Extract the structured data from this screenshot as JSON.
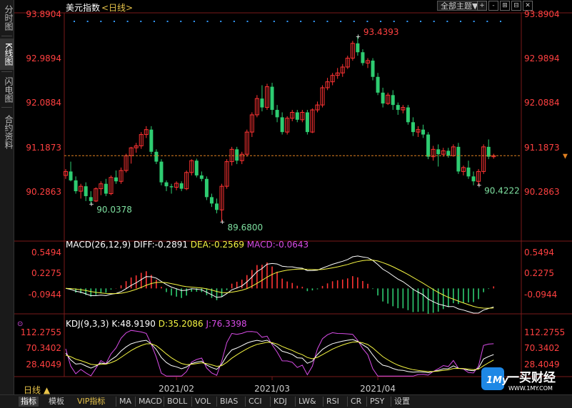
{
  "sidebar": {
    "tabs": [
      {
        "label": "分时图",
        "active": false
      },
      {
        "label": "K线图",
        "active": true
      },
      {
        "label": "闪电图",
        "active": false
      },
      {
        "label": "合约资料",
        "active": false
      }
    ]
  },
  "header": {
    "title": "美元指数",
    "period": "<日线>",
    "theme_select": "全部主题▼",
    "buttons": [
      "+",
      "-",
      "⊞",
      "⊟",
      "✕"
    ]
  },
  "period_selector": "日线 ▲",
  "bottom_tabs": [
    "指标",
    "模板",
    "VIP指标",
    "MA",
    "MACD",
    "BOLL",
    "VOL",
    "BIAS",
    "CCI",
    "KDJ",
    "LW&",
    "RSI",
    "CR",
    "PSY",
    "设置"
  ],
  "watermark": {
    "brand": "一买财经",
    "url": "WWW.1MY.COM"
  },
  "colors": {
    "up": "#ff3333",
    "down": "#2ecc71",
    "axis_text": "#ff4040",
    "diff": "#ffffff",
    "dea": "#f5f542",
    "macd": "#d94ce8",
    "k": "#ffffff",
    "d": "#f5f542",
    "j": "#d94ce8",
    "dots": "#3399ff"
  },
  "chart_data": [
    {
      "type": "candlestick",
      "title": "美元指数",
      "yticks": [
        "93.8904",
        "92.9894",
        "92.0884",
        "91.1873",
        "90.2863"
      ],
      "ylim": [
        89.5,
        93.95
      ],
      "current_price": 91.02,
      "xticks": [
        {
          "label": "2021/02",
          "index": 22
        },
        {
          "label": "2021/03",
          "index": 41
        },
        {
          "label": "2021/04",
          "index": 62
        }
      ],
      "annotations": [
        {
          "text": "93.4393",
          "index": 58,
          "value": 93.4393,
          "kind": "high"
        },
        {
          "text": "89.6800",
          "index": 31,
          "value": 89.68,
          "kind": "low"
        },
        {
          "text": "90.0378",
          "index": 5,
          "value": 90.0378,
          "kind": "low"
        },
        {
          "text": "90.4222",
          "index": 82,
          "value": 90.4222,
          "kind": "low"
        }
      ],
      "dots_count": 33,
      "candles": [
        [
          90.62,
          90.75,
          90.55,
          90.7
        ],
        [
          90.7,
          90.9,
          90.5,
          90.52
        ],
        [
          90.52,
          90.6,
          90.25,
          90.3
        ],
        [
          90.3,
          90.45,
          90.15,
          90.4
        ],
        [
          90.4,
          90.48,
          90.1,
          90.2
        ],
        [
          90.18,
          90.3,
          90.04,
          90.1
        ],
        [
          90.1,
          90.38,
          90.08,
          90.35
        ],
        [
          90.35,
          90.5,
          90.22,
          90.45
        ],
        [
          90.45,
          90.55,
          90.2,
          90.25
        ],
        [
          90.25,
          90.62,
          90.22,
          90.58
        ],
        [
          90.58,
          90.72,
          90.45,
          90.5
        ],
        [
          90.5,
          90.78,
          90.45,
          90.72
        ],
        [
          90.72,
          91.06,
          90.68,
          91.02
        ],
        [
          91.02,
          91.2,
          90.86,
          91.18
        ],
        [
          91.18,
          91.28,
          91.08,
          91.22
        ],
        [
          91.22,
          91.5,
          91.16,
          91.45
        ],
        [
          91.45,
          91.62,
          91.38,
          91.55
        ],
        [
          91.55,
          91.62,
          91.05,
          91.1
        ],
        [
          91.1,
          91.15,
          90.85,
          90.9
        ],
        [
          90.9,
          90.95,
          90.42,
          90.48
        ],
        [
          90.48,
          90.52,
          90.3,
          90.4
        ],
        [
          90.4,
          90.45,
          90.25,
          90.38
        ],
        [
          90.38,
          90.5,
          90.32,
          90.46
        ],
        [
          90.46,
          90.5,
          90.3,
          90.35
        ],
        [
          90.35,
          90.72,
          90.32,
          90.68
        ],
        [
          90.68,
          90.95,
          90.62,
          90.92
        ],
        [
          90.92,
          90.96,
          90.58,
          90.62
        ],
        [
          90.62,
          90.7,
          90.5,
          90.55
        ],
        [
          90.55,
          90.6,
          90.12,
          90.18
        ],
        [
          90.18,
          90.25,
          89.98,
          90.05
        ],
        [
          90.05,
          90.15,
          89.85,
          89.92
        ],
        [
          89.92,
          90.45,
          89.68,
          90.4
        ],
        [
          90.4,
          90.95,
          90.35,
          90.9
        ],
        [
          90.9,
          91.2,
          90.82,
          91.15
        ],
        [
          91.15,
          91.2,
          90.85,
          90.92
        ],
        [
          90.92,
          91.1,
          90.85,
          91.05
        ],
        [
          91.05,
          91.55,
          91.0,
          91.5
        ],
        [
          91.5,
          91.9,
          91.4,
          91.85
        ],
        [
          91.85,
          92.25,
          91.8,
          92.18
        ],
        [
          92.18,
          92.45,
          91.92,
          92.0
        ],
        [
          92.0,
          92.48,
          91.95,
          92.42
        ],
        [
          92.42,
          92.5,
          91.85,
          91.95
        ],
        [
          91.95,
          92.05,
          91.7,
          91.8
        ],
        [
          91.8,
          91.9,
          91.45,
          91.5
        ],
        [
          91.5,
          91.82,
          91.45,
          91.78
        ],
        [
          91.78,
          91.95,
          91.72,
          91.9
        ],
        [
          91.9,
          91.95,
          91.7,
          91.75
        ],
        [
          91.75,
          91.95,
          91.7,
          91.9
        ],
        [
          91.9,
          91.95,
          91.45,
          91.5
        ],
        [
          91.5,
          91.98,
          91.48,
          91.95
        ],
        [
          91.95,
          92.12,
          91.9,
          92.05
        ],
        [
          92.05,
          92.45,
          92.0,
          92.4
        ],
        [
          92.4,
          92.6,
          92.35,
          92.52
        ],
        [
          92.52,
          92.7,
          92.45,
          92.65
        ],
        [
          92.65,
          92.8,
          92.58,
          92.7
        ],
        [
          92.7,
          92.88,
          92.62,
          92.82
        ],
        [
          92.82,
          93.05,
          92.78,
          93.0
        ],
        [
          93.0,
          93.35,
          92.95,
          93.3
        ],
        [
          93.3,
          93.44,
          93.05,
          93.12
        ],
        [
          93.12,
          93.18,
          92.85,
          92.9
        ],
        [
          92.9,
          93.0,
          92.8,
          92.95
        ],
        [
          92.95,
          93.0,
          92.55,
          92.62
        ],
        [
          92.62,
          92.7,
          92.25,
          92.3
        ],
        [
          92.3,
          92.4,
          92.0,
          92.08
        ],
        [
          92.08,
          92.3,
          92.05,
          92.25
        ],
        [
          92.25,
          92.35,
          91.95,
          92.05
        ],
        [
          92.05,
          92.1,
          91.85,
          91.95
        ],
        [
          91.95,
          92.05,
          91.88,
          92.0
        ],
        [
          92.0,
          92.05,
          91.65,
          91.7
        ],
        [
          91.7,
          91.8,
          91.42,
          91.5
        ],
        [
          91.5,
          91.62,
          91.4,
          91.55
        ],
        [
          91.55,
          91.65,
          91.38,
          91.45
        ],
        [
          91.45,
          91.5,
          90.95,
          91.0
        ],
        [
          91.0,
          91.22,
          90.92,
          91.15
        ],
        [
          91.15,
          91.25,
          90.8,
          91.05
        ],
        [
          91.05,
          91.18,
          91.0,
          91.12
        ],
        [
          91.12,
          91.18,
          90.98,
          91.02
        ],
        [
          91.02,
          91.25,
          91.0,
          91.2
        ],
        [
          91.2,
          91.28,
          90.65,
          90.7
        ],
        [
          90.7,
          90.82,
          90.62,
          90.78
        ],
        [
          90.78,
          90.92,
          90.55,
          90.6
        ],
        [
          90.6,
          90.7,
          90.42,
          90.5
        ],
        [
          90.5,
          90.75,
          90.42,
          90.7
        ],
        [
          90.7,
          91.25,
          90.65,
          91.2
        ],
        [
          91.2,
          91.35,
          90.95,
          91.0
        ],
        [
          91.0,
          91.06,
          90.96,
          91.02
        ]
      ]
    },
    {
      "type": "line+bar",
      "title": "MACD(26,12,9)",
      "series": [
        {
          "name": "DIFF",
          "last": "-0.2891"
        },
        {
          "name": "DEA",
          "last": "-0.2569"
        },
        {
          "name": "MACD",
          "last": "-0.0643"
        }
      ],
      "yticks": [
        "0.5494",
        "0.2275",
        "-0.0944"
      ],
      "ylim": [
        -0.42,
        0.62
      ]
    },
    {
      "type": "line",
      "title": "KDJ(9,3,3)",
      "series": [
        {
          "name": "K",
          "last": "48.9190"
        },
        {
          "name": "D",
          "last": "35.2086"
        },
        {
          "name": "J",
          "last": "76.3398"
        }
      ],
      "yticks": [
        "112.2755",
        "70.3402",
        "28.4049"
      ],
      "ylim": [
        -5,
        122
      ]
    }
  ]
}
